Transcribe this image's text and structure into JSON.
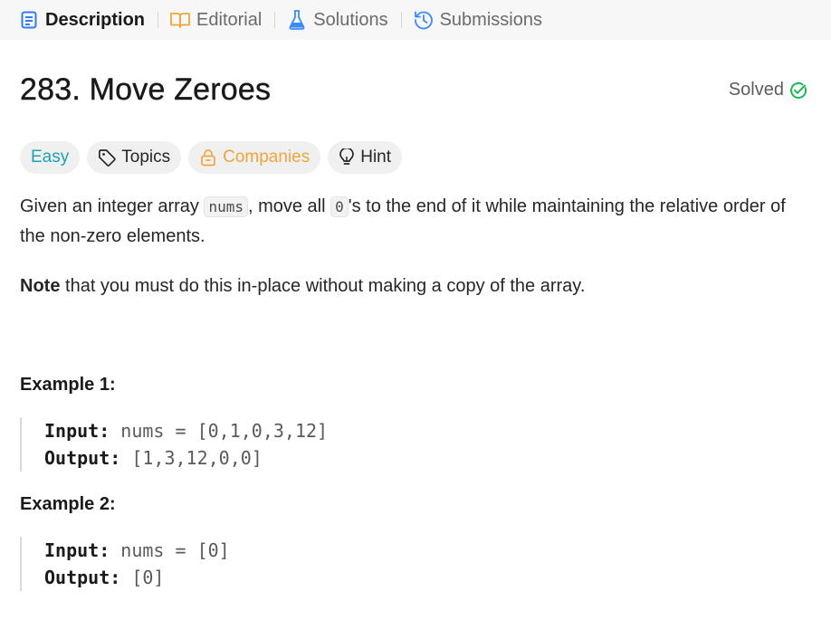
{
  "tabs": [
    {
      "label": "Description",
      "icon": "description-icon",
      "active": true
    },
    {
      "label": "Editorial",
      "icon": "book-icon",
      "active": false
    },
    {
      "label": "Solutions",
      "icon": "flask-icon",
      "active": false
    },
    {
      "label": "Submissions",
      "icon": "history-icon",
      "active": false
    }
  ],
  "problem": {
    "title": "283. Move Zeroes",
    "status": "Solved",
    "status_icon": "check-circle-icon",
    "status_color": "#1db954"
  },
  "tags": {
    "difficulty": "Easy",
    "topics": "Topics",
    "companies": "Companies",
    "hint": "Hint",
    "difficulty_color": "#1aa3b2",
    "companies_color": "#f0a53a"
  },
  "description": {
    "p1_a": "Given an integer array ",
    "p1_code1": "nums",
    "p1_b": ", move all ",
    "p1_code2": "0",
    "p1_c": "'s to the end of it while maintaining the relative order of the non-zero elements.",
    "p2_bold": "Note",
    "p2_rest": " that you must do this in-place without making a copy of the array."
  },
  "examples": [
    {
      "title": "Example 1:",
      "input_label": "Input:",
      "input": "nums = [0,1,0,3,12]",
      "output_label": "Output:",
      "output": "[1,3,12,0,0]"
    },
    {
      "title": "Example 2:",
      "input_label": "Input:",
      "input": "nums = [0]",
      "output_label": "Output:",
      "output": "[0]"
    }
  ]
}
